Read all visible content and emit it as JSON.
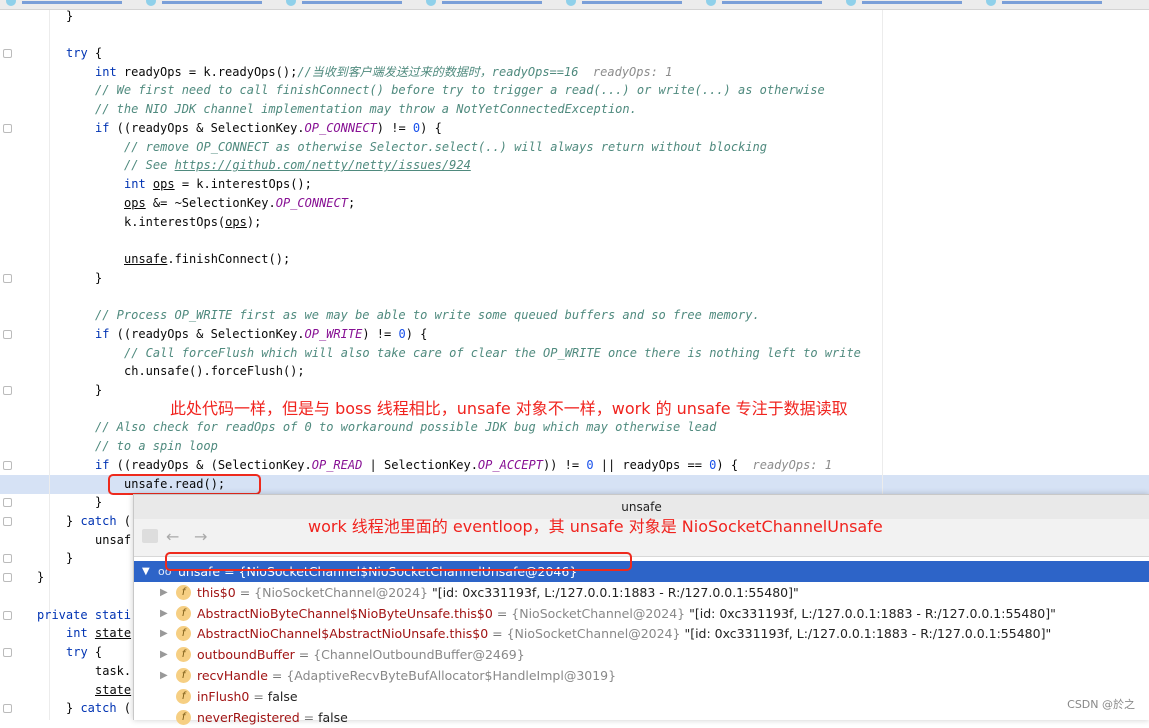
{
  "code_lines": [
    [
      [
        "}",
        ""
      ]
    ],
    [],
    [
      [
        "try",
        "kw"
      ],
      [
        " {",
        ""
      ]
    ],
    [
      [
        "int",
        "kw"
      ],
      [
        " readyOps = k.readyOps();",
        ""
      ],
      [
        "//当收到客户端发送过来的数据时，readyOps==16",
        "cm"
      ],
      [
        "  readyOps: 1",
        "hint"
      ]
    ],
    [
      [
        "// We first need to call finishConnect() before try to trigger a read(...) or write(...) as otherwise",
        "cm"
      ]
    ],
    [
      [
        "// the NIO JDK channel implementation may throw a NotYetConnectedException.",
        "cm"
      ]
    ],
    [
      [
        "if",
        "kw"
      ],
      [
        " ((readyOps & SelectionKey.",
        ""
      ],
      [
        "OP_CONNECT",
        "cn"
      ],
      [
        ") != ",
        ""
      ],
      [
        "0",
        "num"
      ],
      [
        ") {",
        ""
      ]
    ],
    [
      [
        "// remove OP_CONNECT as otherwise Selector.select(..) will always return without blocking",
        "cm"
      ]
    ],
    [
      [
        "// See ",
        "cm"
      ],
      [
        "https://github.com/netty/netty/issues/924",
        "lnk"
      ]
    ],
    [
      [
        "int",
        "kw"
      ],
      [
        " ",
        ""
      ],
      [
        "ops",
        "ul"
      ],
      [
        " = k.interestOps();",
        ""
      ]
    ],
    [
      [
        "ops",
        "ul"
      ],
      [
        " &= ~SelectionKey.",
        ""
      ],
      [
        "OP_CONNECT",
        "cn"
      ],
      [
        ";",
        ""
      ]
    ],
    [
      [
        "k.interestOps(",
        ""
      ],
      [
        "ops",
        "ul"
      ],
      [
        ");",
        ""
      ]
    ],
    [],
    [
      [
        "unsafe",
        "ul"
      ],
      [
        ".finishConnect();",
        ""
      ]
    ],
    [
      [
        "}",
        ""
      ]
    ],
    [],
    [
      [
        "// Process OP_WRITE first as we may be able to write some queued buffers and so free memory.",
        "cm"
      ]
    ],
    [
      [
        "if",
        "kw"
      ],
      [
        " ((readyOps & SelectionKey.",
        ""
      ],
      [
        "OP_WRITE",
        "cn"
      ],
      [
        ") != ",
        ""
      ],
      [
        "0",
        "num"
      ],
      [
        ") {",
        ""
      ]
    ],
    [
      [
        "// Call forceFlush which will also take care of clear the OP_WRITE once there is nothing left to write",
        "cm"
      ]
    ],
    [
      [
        "ch.unsafe().forceFlush();",
        ""
      ]
    ],
    [
      [
        "}",
        ""
      ]
    ],
    [],
    [
      [
        "// Also check for readOps of 0 to workaround possible JDK bug which may otherwise lead",
        "cm"
      ]
    ],
    [
      [
        "// to a spin loop",
        "cm"
      ]
    ],
    [
      [
        "if",
        "kw"
      ],
      [
        " ((readyOps & (SelectionKey.",
        ""
      ],
      [
        "OP_READ",
        "cn"
      ],
      [
        " | SelectionKey.",
        ""
      ],
      [
        "OP_ACCEPT",
        "cn"
      ],
      [
        ")) != ",
        ""
      ],
      [
        "0",
        "num"
      ],
      [
        " || readyOps == ",
        ""
      ],
      [
        "0",
        "num"
      ],
      [
        ") {",
        ""
      ],
      [
        "  readyOps: 1",
        "hint"
      ]
    ],
    [
      [
        "unsafe.read();",
        ""
      ]
    ],
    [
      [
        "}",
        ""
      ]
    ],
    [
      [
        "} ",
        ""
      ],
      [
        "catch",
        "kw"
      ],
      [
        " (",
        ""
      ]
    ],
    [
      [
        "unsaf",
        ""
      ]
    ],
    [
      [
        "}",
        ""
      ]
    ],
    [
      [
        "}",
        ""
      ]
    ],
    [],
    [
      [
        "private",
        "kw"
      ],
      [
        " ",
        ""
      ],
      [
        "stati",
        "kw"
      ]
    ],
    [
      [
        "int",
        "kw"
      ],
      [
        " ",
        ""
      ],
      [
        "state",
        "ul"
      ]
    ],
    [
      [
        "try",
        "kw"
      ],
      [
        " {",
        ""
      ]
    ],
    [
      [
        "task.",
        ""
      ]
    ],
    [
      [
        "state",
        "ul"
      ]
    ],
    [
      [
        "} ",
        ""
      ],
      [
        "catch",
        "kw"
      ],
      [
        " (",
        ""
      ]
    ]
  ],
  "code_indents": [
    1,
    0,
    1,
    2,
    2,
    2,
    2,
    3,
    3,
    3,
    3,
    3,
    0,
    3,
    2,
    0,
    2,
    2,
    3,
    3,
    2,
    0,
    2,
    2,
    2,
    3,
    2,
    1,
    2,
    1,
    0,
    0,
    0,
    1,
    1,
    2,
    2,
    1
  ],
  "annotations": {
    "note1": "此处代码一样，但是与 boss 线程相比，unsafe 对象不一样，work 的 unsafe 专注于数据读取",
    "note2": "work 线程池里面的 eventloop，其 unsafe 对象是 NioSocketChannelUnsafe"
  },
  "popup": {
    "title": "unsafe",
    "toolbar": {
      "back_icon": "←",
      "forward_icon": "→"
    },
    "rows": [
      {
        "name": "unsafe",
        "eq": " = ",
        "ref": "{NioSocketChannel$NioSocketChannelUnsafe@2046}",
        "val": "",
        "expandable": true,
        "expanded": true,
        "selected": true,
        "icon": "oo"
      },
      {
        "name": "this$0",
        "eq": " = ",
        "ref": "{NioSocketChannel@2024}",
        "val": " \"[id: 0xc331193f, L:/127.0.0.1:1883 - R:/127.0.0.1:55480]\"",
        "expandable": true,
        "icon": "f"
      },
      {
        "name": "AbstractNioByteChannel$NioByteUnsafe.this$0",
        "eq": " = ",
        "ref": "{NioSocketChannel@2024}",
        "val": " \"[id: 0xc331193f, L:/127.0.0.1:1883 - R:/127.0.0.1:55480]\"",
        "expandable": true,
        "icon": "f"
      },
      {
        "name": "AbstractNioChannel$AbstractNioUnsafe.this$0",
        "eq": " = ",
        "ref": "{NioSocketChannel@2024}",
        "val": " \"[id: 0xc331193f, L:/127.0.0.1:1883 - R:/127.0.0.1:55480]\"",
        "expandable": true,
        "icon": "f"
      },
      {
        "name": "outboundBuffer",
        "eq": " = ",
        "ref": "{ChannelOutboundBuffer@2469}",
        "val": "",
        "expandable": true,
        "icon": "f"
      },
      {
        "name": "recvHandle",
        "eq": " = ",
        "ref": "{AdaptiveRecvByteBufAllocator$HandleImpl@3019}",
        "val": "",
        "expandable": true,
        "icon": "f"
      },
      {
        "name": "inFlush0",
        "eq": " = ",
        "ref": "",
        "val": "false",
        "expandable": false,
        "icon": "f"
      },
      {
        "name": "neverRegistered",
        "eq": " = ",
        "ref": "",
        "val": "false",
        "expandable": false,
        "icon": "f"
      }
    ]
  },
  "watermark": "CSDN @於之",
  "colors": {
    "selection": "#2d64c8",
    "annotation": "#f0231e",
    "exec_line": "#d6e2f5"
  }
}
